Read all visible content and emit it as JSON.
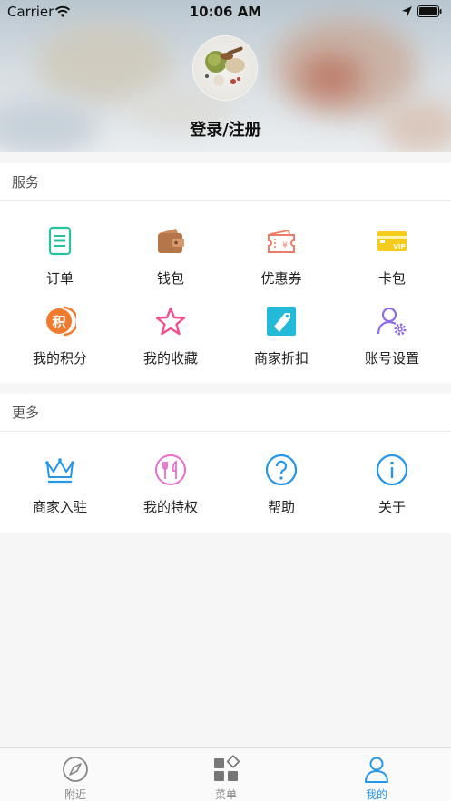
{
  "status_bar": {
    "carrier": "Carrier",
    "time": "10:06 AM"
  },
  "profile": {
    "login_label": "登录/注册"
  },
  "services": {
    "title": "服务",
    "items": [
      {
        "label": "订单",
        "icon": "order-icon"
      },
      {
        "label": "钱包",
        "icon": "wallet-icon"
      },
      {
        "label": "优惠券",
        "icon": "coupon-icon"
      },
      {
        "label": "卡包",
        "icon": "vip-card-icon"
      },
      {
        "label": "我的积分",
        "icon": "points-icon"
      },
      {
        "label": "我的收藏",
        "icon": "star-icon"
      },
      {
        "label": "商家折扣",
        "icon": "discount-tag-icon"
      },
      {
        "label": "账号设置",
        "icon": "account-settings-icon"
      }
    ]
  },
  "more": {
    "title": "更多",
    "items": [
      {
        "label": "商家入驻",
        "icon": "crown-icon"
      },
      {
        "label": "我的特权",
        "icon": "dining-privilege-icon"
      },
      {
        "label": "帮助",
        "icon": "help-icon"
      },
      {
        "label": "关于",
        "icon": "info-icon"
      }
    ]
  },
  "tabbar": {
    "items": [
      {
        "label": "附近",
        "icon": "compass-icon",
        "active": false
      },
      {
        "label": "菜单",
        "icon": "menu-grid-icon",
        "active": false
      },
      {
        "label": "我的",
        "icon": "user-icon",
        "active": true
      }
    ]
  },
  "colors": {
    "accent": "#2596e8",
    "order": "#26c29e",
    "wallet": "#b5764a",
    "coupon": "#ee7d67",
    "vip": "#f5cc1c",
    "points": "#f07a2e",
    "favorite": "#f0508f",
    "discount": "#23b9d8",
    "settings": "#8f6de8"
  }
}
